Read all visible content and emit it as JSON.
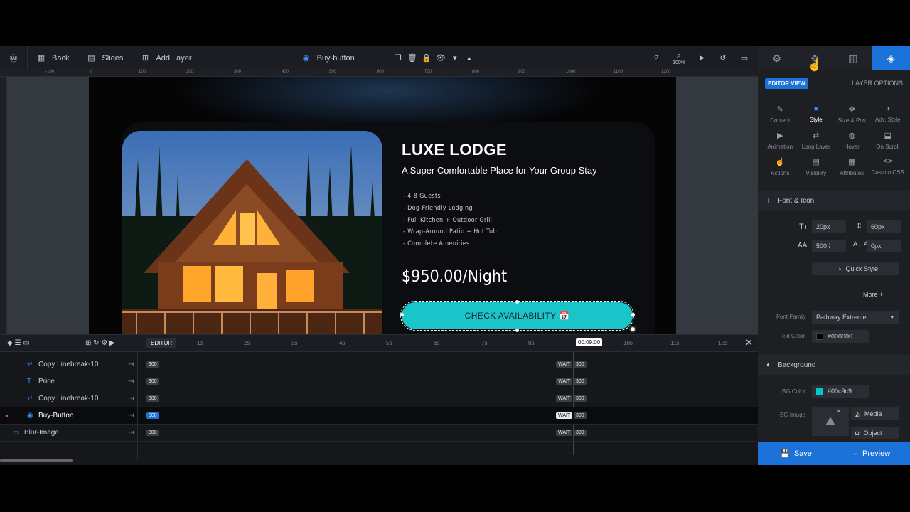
{
  "toolbar": {
    "back": "Back",
    "slides": "Slides",
    "add_layer": "Add Layer",
    "selected_layer": "Buy-button",
    "zoom": "100%"
  },
  "ruler": {
    "ticks": [
      "-100",
      "0",
      "100",
      "200",
      "300",
      "400",
      "500",
      "600",
      "700",
      "800",
      "900",
      "1000",
      "1100",
      "1200"
    ]
  },
  "slide": {
    "headline": "LUXE LODGE",
    "subline": "A Super Comfortable Place for Your Group Stay",
    "features": [
      "- 4-8 Guests",
      "- Dog-Friendly Lodging",
      "- Full Kitchen + Outdoor Grill",
      "- Wrap-Around Patio + Hot Tub",
      "- Complete Amenities"
    ],
    "price": "$950.00/Night",
    "cta": "CHECK AVAILABILITY 📅",
    "cta_color": "#19c5c9"
  },
  "timeline": {
    "editor_tab": "EDITOR",
    "time_marks": [
      "1s",
      "2s",
      "3s",
      "4s",
      "5s",
      "6s",
      "7s",
      "8s",
      "",
      "10s",
      "11s",
      "12s"
    ],
    "current_time": "00:09:00",
    "rows": [
      {
        "name": "Copy Linebreak-10",
        "icon": "↵",
        "duration": "300",
        "wait": "WAIT",
        "end": "300"
      },
      {
        "name": "Price",
        "icon": "T",
        "duration": "300",
        "wait": "WAIT",
        "end": "300"
      },
      {
        "name": "Copy Linebreak-10",
        "icon": "↵",
        "duration": "300",
        "wait": "WAIT",
        "end": "300"
      },
      {
        "name": "Buy-Button",
        "icon": "◉",
        "duration": "300",
        "wait": "WAIT",
        "end": "300"
      },
      {
        "name": "Blur-Image",
        "icon": "▭",
        "duration": "300",
        "wait": "WAIT",
        "end": "300"
      }
    ]
  },
  "panel": {
    "editor_view": "EDITOR VIEW",
    "layer_options": "LAYER OPTIONS",
    "options": [
      {
        "label": "Content",
        "icon": "✎"
      },
      {
        "label": "Style",
        "icon": "●"
      },
      {
        "label": "Size & Pos",
        "icon": "✥"
      },
      {
        "label": "Adv. Style",
        "icon": "◑"
      },
      {
        "label": "Animation",
        "icon": "▶"
      },
      {
        "label": "Loop Layer",
        "icon": "⇄"
      },
      {
        "label": "Hover",
        "icon": "◍"
      },
      {
        "label": "On Scroll",
        "icon": "⬓"
      },
      {
        "label": "Actions",
        "icon": "☝"
      },
      {
        "label": "Visibility",
        "icon": "▤"
      },
      {
        "label": "Attributes",
        "icon": "▦"
      },
      {
        "label": "Custom CSS",
        "icon": "<>"
      }
    ],
    "font_section": "Font & Icon",
    "font_size": "20px",
    "line_height": "60px",
    "font_weight": "500 ⁞",
    "letter_spacing": "0px",
    "quick_style": "Quick Style",
    "more": "More",
    "font_family_label": "Font Family",
    "font_family": "Pathway Extreme",
    "text_color_label": "Text Color",
    "text_color": "#000000",
    "background_section": "Background",
    "bg_color_label": "BG Color",
    "bg_color": "#00c9c9",
    "bg_image_label": "BG Image",
    "media": "Media",
    "object": "Object",
    "save": "Save",
    "preview": "Preview"
  }
}
